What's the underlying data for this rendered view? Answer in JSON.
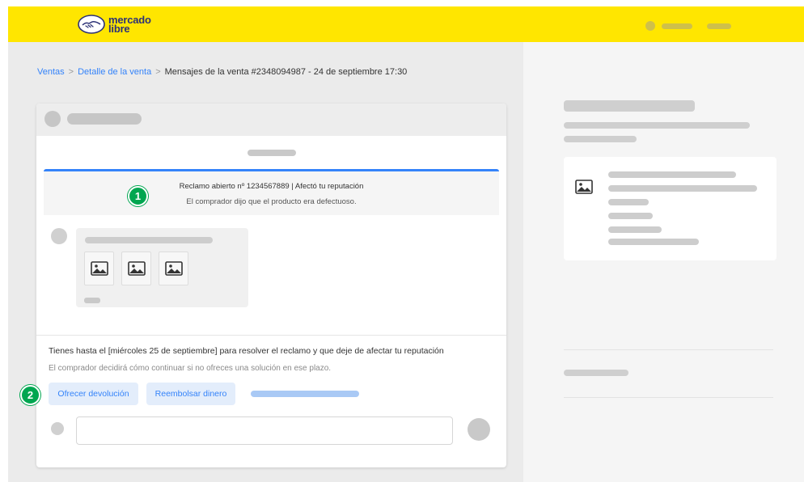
{
  "header": {
    "brand_line1": "mercado",
    "brand_line2": "libre",
    "brand_color": "#ffe600",
    "brand_text_color": "#2d3277"
  },
  "breadcrumb": {
    "items": [
      "Ventas",
      "Detalle de la venta"
    ],
    "separator": ">",
    "current": "Mensajes de la venta #2348094987 - 24 de septiembre 17:30"
  },
  "claim": {
    "title": "Reclamo abierto nº 1234567889 | Afectó tu reputación",
    "description": "El comprador dijo que el producto era defectuoso.",
    "accent_color": "#3483fa"
  },
  "steps": {
    "step1": "1",
    "step2": "2",
    "badge_color": "#00a650"
  },
  "resolution": {
    "deadline": "Tienes hasta el [miércoles 25 de septiembre] para resolver el reclamo y que deje de afectar tu reputación",
    "note": "El comprador decidirá cómo continuar si no ofreces una solución en ese plazo.",
    "buttons": {
      "return": "Ofrecer devolución",
      "refund": "Reembolsar dinero"
    }
  },
  "icons": {
    "logo": "handshake-logo-icon",
    "image": "image-placeholder-icon"
  }
}
